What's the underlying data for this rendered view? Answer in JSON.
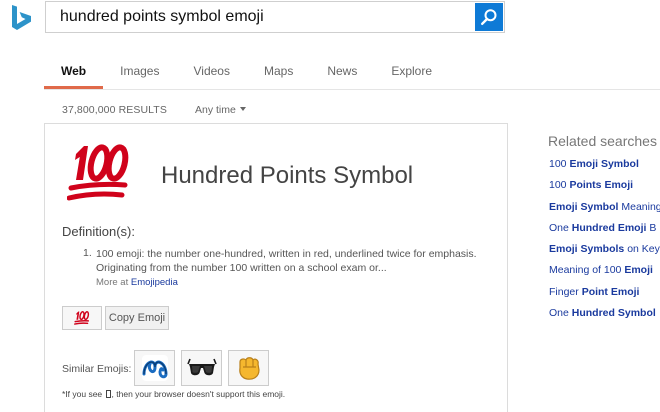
{
  "search": {
    "query": "hundred points symbol emoji"
  },
  "tabs": [
    {
      "label": "Web",
      "active": true
    },
    {
      "label": "Images",
      "active": false
    },
    {
      "label": "Videos",
      "active": false
    },
    {
      "label": "Maps",
      "active": false
    },
    {
      "label": "News",
      "active": false
    },
    {
      "label": "Explore",
      "active": false
    }
  ],
  "results": {
    "count": "37,800,000 RESULTS",
    "time_filter": "Any time"
  },
  "card": {
    "title": "Hundred Points Symbol",
    "hero_icon": "hundred-points-emoji",
    "definitions_heading": "Definition(s):",
    "definition_number": "1.",
    "definition_text": "100 emoji: the number one-hundred, written in red, underlined twice for emphasis. Originating from the number 100 written on a school exam or...",
    "more_at_prefix": "More at",
    "more_at_link": "Emojipedia",
    "copy_button": "Copy Emoji",
    "similar_label": "Similar Emojis:",
    "similar_emojis": [
      "double-curly-loop-emoji",
      "sunglasses-emoji",
      "fisted-hand-emoji"
    ],
    "footnote_prefix": "*If you see",
    "footnote_suffix": ", then your browser doesn't support this emoji."
  },
  "related": {
    "heading": "Related searches",
    "items": [
      {
        "plain_before": "100 ",
        "bold": "Emoji Symbol",
        "plain_after": ""
      },
      {
        "plain_before": "100 ",
        "bold": "Points Emoji",
        "plain_after": ""
      },
      {
        "plain_before": "",
        "bold": "Emoji Symbol",
        "plain_after": " Meaning"
      },
      {
        "plain_before": "One ",
        "bold": "Hundred Emoji",
        "plain_after": " B"
      },
      {
        "plain_before": "",
        "bold": "Emoji Symbols",
        "plain_after": " on Key"
      },
      {
        "plain_before": "Meaning of 100 ",
        "bold": "Emoji",
        "plain_after": ""
      },
      {
        "plain_before": "Finger ",
        "bold": "Point Emoji",
        "plain_after": ""
      },
      {
        "plain_before": "One ",
        "bold": "Hundred Symbol",
        "plain_after": ""
      }
    ]
  },
  "colors": {
    "accent": "#e06a4a",
    "search_button": "#0e7ad6",
    "link": "#1a3a9e",
    "emoji_red": "#d0021b",
    "logo": "#2d93c9"
  }
}
